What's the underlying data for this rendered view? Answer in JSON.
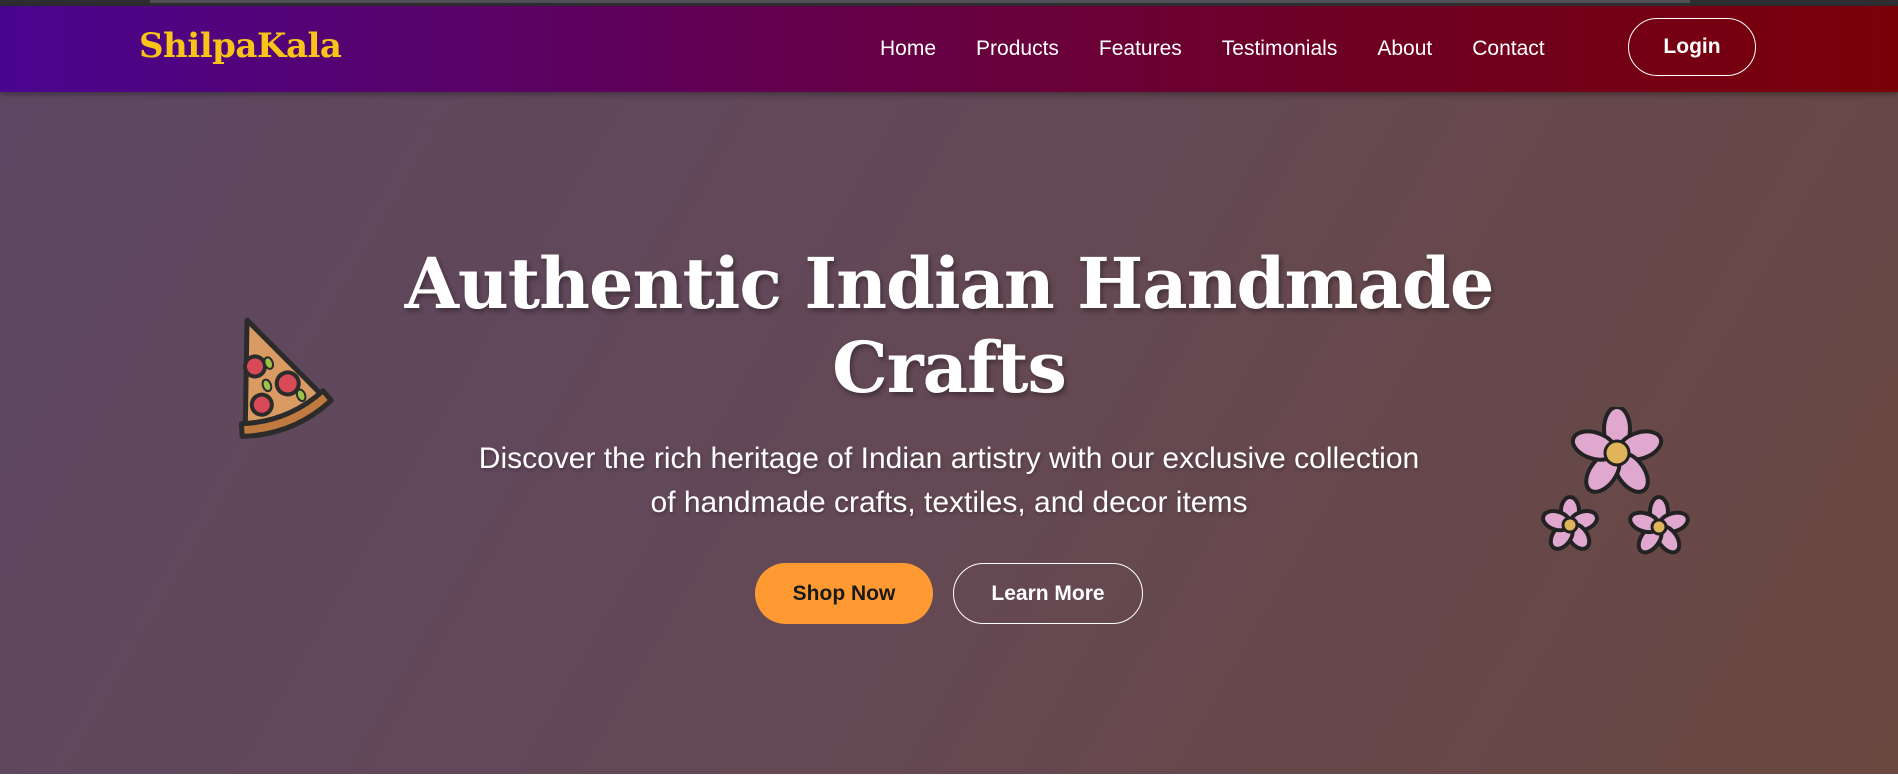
{
  "nav": {
    "logo": "ShilpaKala",
    "links": [
      "Home",
      "Products",
      "Features",
      "Testimonials",
      "About",
      "Contact"
    ],
    "login_label": "Login"
  },
  "hero": {
    "title_line1": "Authentic Indian Handmade",
    "title_line2": "Crafts",
    "subtitle_line1": "Discover the rich heritage of Indian artistry with our exclusive collection",
    "subtitle_line2": "of handmade crafts, textiles, and decor items",
    "primary_button": "Shop Now",
    "secondary_button": "Learn More",
    "decorations": [
      "pizza-icon",
      "flower-icon"
    ]
  },
  "colors": {
    "logo": "#f8c417",
    "primary_button": "#ff9a33",
    "nav_gradient_start": "#4a0590",
    "nav_gradient_end": "#7a0008"
  }
}
